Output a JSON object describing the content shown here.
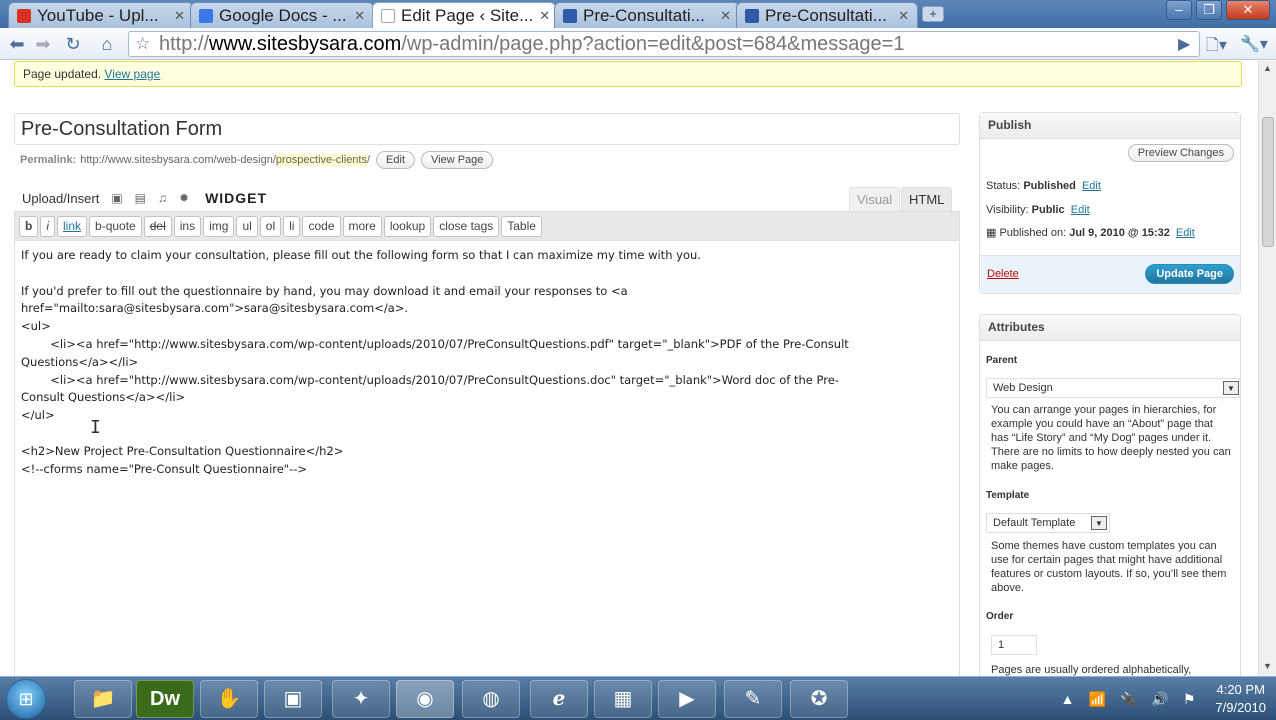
{
  "browser": {
    "tabs": [
      {
        "title": "YouTube - Upl...",
        "color": "#d93025"
      },
      {
        "title": "Google Docs - ...",
        "color": "#3b78e7"
      },
      {
        "title": "Edit Page ‹ Site...",
        "color": "#9aa9bd"
      },
      {
        "title": "Pre-Consultati...",
        "color": "#2e5aa8"
      },
      {
        "title": "Pre-Consultati...",
        "color": "#2e5aa8"
      }
    ],
    "new_tab": "+",
    "url_prefix": "http://",
    "url_host": "www.sitesbysara.com",
    "url_path": "/wp-admin/page.php?action=edit&post=684&message=1"
  },
  "notice": {
    "text": "Page updated.",
    "link": "View page"
  },
  "editor": {
    "title": "Pre-Consultation Form",
    "permalink_label": "Permalink:",
    "permalink_base": "http://www.sitesbysara.com/web-design/",
    "permalink_slug": "prospective-clients",
    "permalink_tail": "/",
    "edit_button": "Edit",
    "view_page_button": "View Page",
    "upload_insert": "Upload/Insert",
    "widget_label": "WIDGET",
    "tab_visual": "Visual",
    "tab_html": "HTML",
    "quicktags": [
      "b",
      "i",
      "link",
      "b-quote",
      "del",
      "ins",
      "img",
      "ul",
      "ol",
      "li",
      "code",
      "more",
      "lookup",
      "close tags",
      "Table"
    ],
    "content": "If you are ready to claim your consultation, please fill out the following form so that I can maximize my time with you.\n\nIf you'd prefer to fill out the questionnaire by hand, you may download it and email your responses to <a\nhref=\"mailto:sara@sitesbysara.com\">sara@sitesbysara.com</a>.\n<ul>\n\t<li><a href=\"http://www.sitesbysara.com/wp-content/uploads/2010/07/PreConsultQuestions.pdf\" target=\"_blank\">PDF of the Pre-Consult\nQuestions</a></li>\n\t<li><a href=\"http://www.sitesbysara.com/wp-content/uploads/2010/07/PreConsultQuestions.doc\" target=\"_blank\">Word doc of the Pre-\nConsult Questions</a></li>\n</ul>\n\n<h2>New Project Pre-Consultation Questionnaire</h2>\n<!--cforms name=\"Pre-Consult Questionnaire\"-->"
  },
  "publish": {
    "heading": "Publish",
    "preview_button": "Preview Changes",
    "status_label": "Status:",
    "status_value": "Published",
    "visibility_label": "Visibility:",
    "visibility_value": "Public",
    "published_on_label": "Published on:",
    "published_on_value": "Jul 9, 2010 @ 15:32",
    "edit_link": "Edit",
    "delete_link": "Delete",
    "update_button": "Update Page"
  },
  "attributes": {
    "heading": "Attributes",
    "parent_label": "Parent",
    "parent_value": "Web Design",
    "parent_help": "You can arrange your pages in hierarchies, for example you could have an “About” page that has “Life Story” and “My Dog” pages under it. There are no limits to how deeply nested you can make pages.",
    "template_label": "Template",
    "template_value": "Default Template",
    "template_help": "Some themes have custom templates you can use for certain pages that might have additional features or custom layouts. If so, you’ll see them above.",
    "order_label": "Order",
    "order_value": "1",
    "order_help": "Pages are usually ordered alphabetically,"
  },
  "taskbar": {
    "items": [
      "",
      "",
      "Dw",
      "",
      "",
      "",
      "",
      "",
      "",
      "",
      "",
      ""
    ],
    "time": "4:20 PM",
    "date": "7/9/2010"
  }
}
